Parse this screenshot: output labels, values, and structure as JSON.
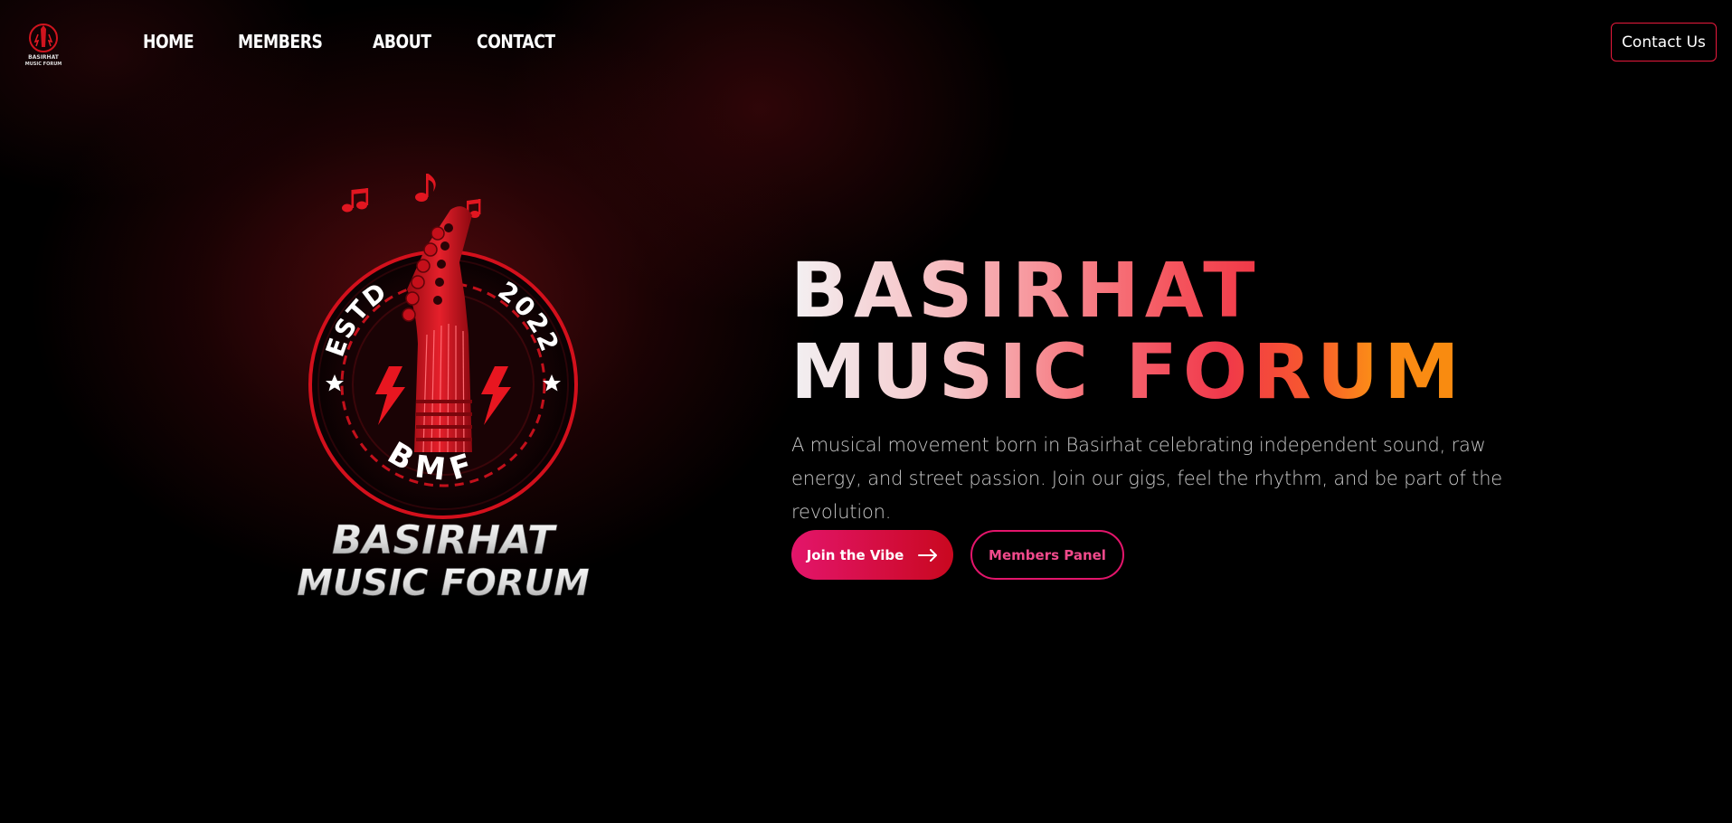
{
  "nav": {
    "logo_text": [
      "BASIRHAT",
      "MUSIC FORUM"
    ],
    "links": [
      "HOME",
      "MEMBERS",
      "ABOUT",
      "CONTACT"
    ],
    "contact_button": "Contact Us"
  },
  "hero": {
    "logo": {
      "estd": "ESTD",
      "year": "2022",
      "initials": "BMF",
      "name_line1": "BASIRHAT",
      "name_line2": "MUSIC FORUM"
    },
    "title_line1": "BASIRHAT",
    "title_line2": "MUSIC FORUM",
    "description": "A musical movement born in Basirhat celebrating independent sound, raw energy, and street passion. Join our gigs, feel the rhythm, and be part of the revolution.",
    "primary_button": "Join the Vibe",
    "secondary_button": "Members Panel"
  },
  "colors": {
    "accent": "#e8193c",
    "button_gradient_start": "#e3156b",
    "button_gradient_end": "#c9081f",
    "title_orange": "#fb8a18",
    "background": "#000000"
  },
  "icons": {
    "arrow": "arrow-right-icon",
    "logo": "guitar-emblem-logo"
  }
}
